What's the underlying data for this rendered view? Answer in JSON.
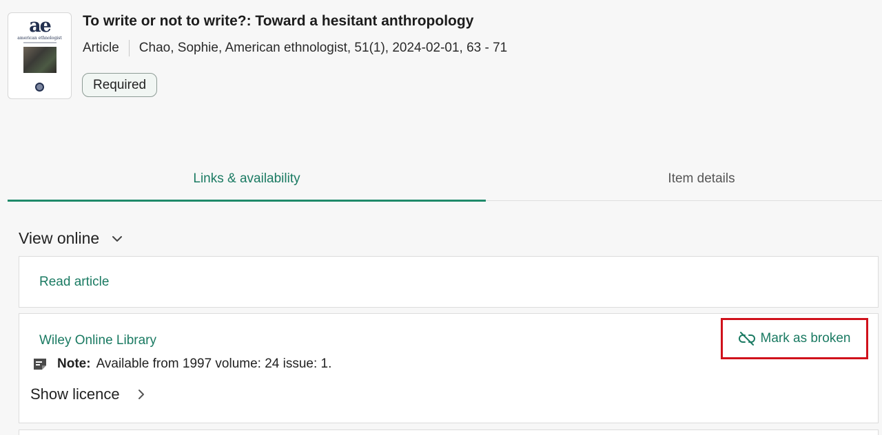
{
  "record": {
    "cover": {
      "logo_text": "ae",
      "journal_text": "american ethnologist"
    },
    "title": "To write or not to write?: Toward a hesitant anthropology",
    "type": "Article",
    "citation": "Chao, Sophie, American ethnologist, 51(1), 2024-02-01, 63 - 71",
    "badge": "Required"
  },
  "tabs": [
    {
      "label": "Links & availability",
      "active": true
    },
    {
      "label": "Item details",
      "active": false
    }
  ],
  "view_online": {
    "heading": "View online",
    "links": [
      {
        "label": "Read article"
      },
      {
        "label": "Wiley Online Library",
        "action": "Mark as broken",
        "note_label": "Note:",
        "note_text": "Available from 1997 volume: 24 issue: 1.",
        "licence_label": "Show licence"
      }
    ]
  },
  "colors": {
    "accent": "#1a7a62",
    "highlight": "#d0111b"
  }
}
